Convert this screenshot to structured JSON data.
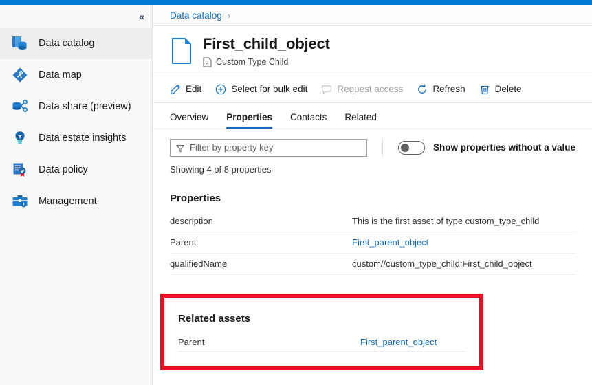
{
  "theme": {
    "accent": "#0078d4",
    "link": "#0f6cbd",
    "highlight_red": "#e81123",
    "sidebar_bg": "#f8f8f8",
    "selected_bg": "#ededed"
  },
  "sidebar": {
    "collapse_glyph": "«",
    "items": [
      {
        "label": "Data catalog",
        "icon": "data-catalog-icon",
        "selected": true
      },
      {
        "label": "Data map",
        "icon": "data-map-icon",
        "selected": false
      },
      {
        "label": "Data share (preview)",
        "icon": "data-share-icon",
        "selected": false
      },
      {
        "label": "Data estate insights",
        "icon": "data-estate-insights-icon",
        "selected": false
      },
      {
        "label": "Data policy",
        "icon": "data-policy-icon",
        "selected": false
      },
      {
        "label": "Management",
        "icon": "management-icon",
        "selected": false
      }
    ]
  },
  "breadcrumb": {
    "root": "Data catalog",
    "separator": "›"
  },
  "asset": {
    "title": "First_child_object",
    "type_label": "Custom Type Child",
    "icon": "document-icon",
    "type_icon": "unknown-type-icon"
  },
  "toolbar": {
    "buttons": [
      {
        "label": "Edit",
        "icon": "pencil-icon",
        "disabled": false
      },
      {
        "label": "Select for bulk edit",
        "icon": "plus-circle-icon",
        "disabled": false
      },
      {
        "label": "Request access",
        "icon": "comment-icon",
        "disabled": true
      },
      {
        "label": "Refresh",
        "icon": "refresh-icon",
        "disabled": false
      },
      {
        "label": "Delete",
        "icon": "trash-icon",
        "disabled": false
      }
    ]
  },
  "tabs": [
    {
      "label": "Overview",
      "active": false
    },
    {
      "label": "Properties",
      "active": true
    },
    {
      "label": "Contacts",
      "active": false
    },
    {
      "label": "Related",
      "active": false
    }
  ],
  "filter": {
    "placeholder": "Filter by property key",
    "value": "",
    "icon": "funnel-icon",
    "toggle_label": "Show properties without a value",
    "toggle_on": false
  },
  "showing_text": "Showing 4 of 8 properties",
  "properties_section": {
    "heading": "Properties",
    "rows": [
      {
        "key": "description",
        "value": "This is the first asset of type custom_type_child",
        "is_link": false
      },
      {
        "key": "Parent",
        "value": "First_parent_object",
        "is_link": true
      },
      {
        "key": "qualifiedName",
        "value": "custom//custom_type_child:First_child_object",
        "is_link": false
      }
    ]
  },
  "related_section": {
    "heading": "Related assets",
    "highlighted": true,
    "rows": [
      {
        "key": "Parent",
        "value": "First_parent_object",
        "is_link": true
      }
    ]
  }
}
